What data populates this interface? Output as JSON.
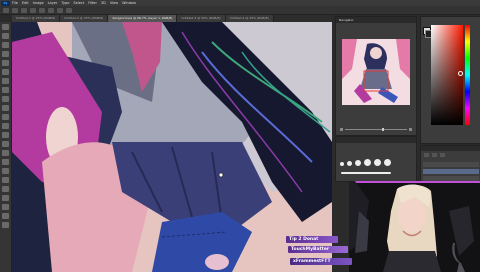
{
  "app": {
    "logo": "Ps"
  },
  "menubar": {
    "items": [
      "File",
      "Edit",
      "Image",
      "Layer",
      "Type",
      "Select",
      "Filter",
      "3D",
      "View",
      "Window"
    ]
  },
  "document_tabs": [
    {
      "label": "Untitled-1 @ 25% (RGB/8)"
    },
    {
      "label": "Untitled-2 @ 25% (RGB/8)"
    },
    {
      "label": "danganronpa @ 66.7% (Layer 1, RGB/8)"
    },
    {
      "label": "Untitled-3 @ 50% (RGB/8)"
    },
    {
      "label": "Untitled-4 @ 25% (RGB/8)"
    }
  ],
  "navigator": {
    "title": "Navigator"
  },
  "alerts": [
    {
      "text": "Tip 2 Donat"
    },
    {
      "text": "TouchMyBatter"
    },
    {
      "text": "xFrammestFTT"
    }
  ],
  "colors": {
    "foreground": "#e0e0e0",
    "background": "#222222",
    "accent_purple": "#7d55c4"
  }
}
